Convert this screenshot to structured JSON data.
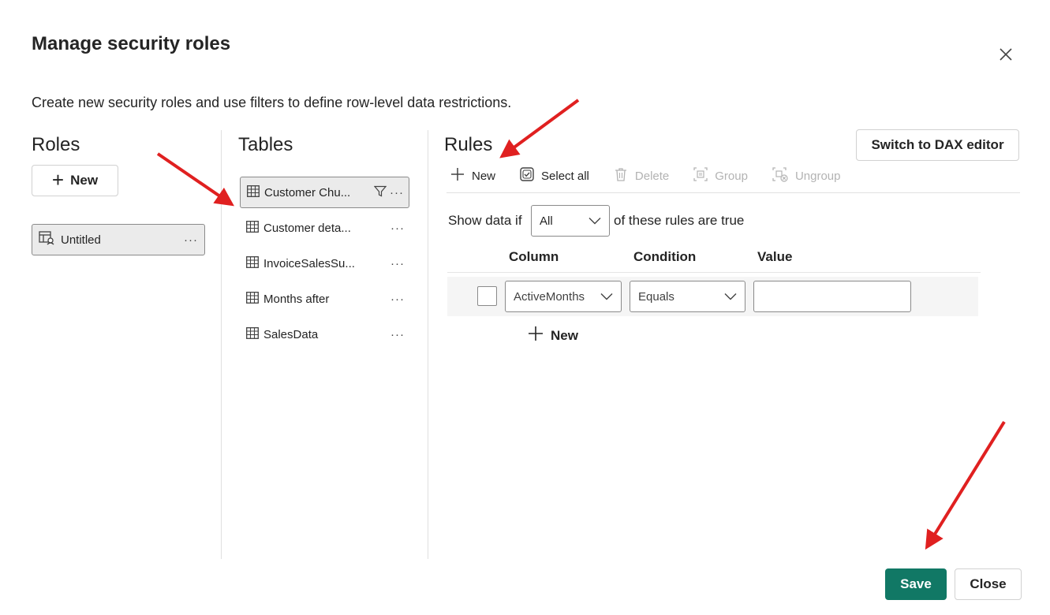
{
  "dialog": {
    "title": "Manage security roles",
    "subtitle": "Create new security roles and use filters to define row-level data restrictions."
  },
  "roles": {
    "heading": "Roles",
    "new_label": "New",
    "items": [
      {
        "label": "Untitled"
      }
    ]
  },
  "tables": {
    "heading": "Tables",
    "items": [
      {
        "label": "Customer Chu..."
      },
      {
        "label": "Customer deta..."
      },
      {
        "label": "InvoiceSalesSu..."
      },
      {
        "label": "Months after"
      },
      {
        "label": "SalesData"
      }
    ]
  },
  "rules": {
    "heading": "Rules",
    "dax_button": "Switch to DAX editor",
    "toolbar": {
      "new": "New",
      "select_all": "Select all",
      "delete": "Delete",
      "group": "Group",
      "ungroup": "Ungroup"
    },
    "show_data_prefix": "Show data if",
    "match_mode": "All",
    "show_data_suffix": "of these rules are true",
    "columns": {
      "column": "Column",
      "condition": "Condition",
      "value": "Value"
    },
    "rows": [
      {
        "column": "ActiveMonths",
        "condition": "Equals",
        "value": ""
      }
    ],
    "add_rule_label": "New"
  },
  "footer": {
    "save": "Save",
    "close": "Close"
  },
  "colors": {
    "primary": "#117865",
    "annotation_arrow": "#e02020"
  }
}
